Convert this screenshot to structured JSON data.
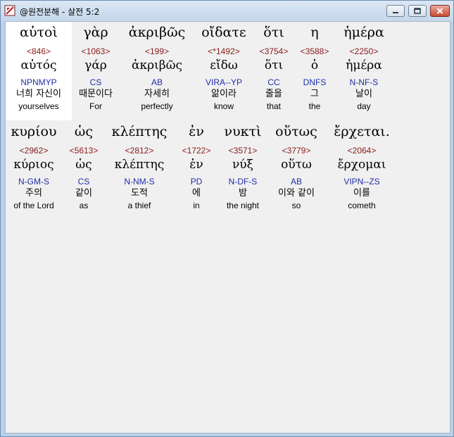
{
  "window": {
    "title": "@원전분해 - 살전 5:2"
  },
  "words": [
    {
      "surface": "αὐτοὶ",
      "strong": "<846>",
      "lemma": "αὐτός",
      "parse": "NPNMYP",
      "korean": "너희 자신이",
      "english": "yourselves"
    },
    {
      "surface": "γὰρ",
      "strong": "<1063>",
      "lemma": "γάρ",
      "parse": "CS",
      "korean": "때문이다",
      "english": "For"
    },
    {
      "surface": "ἀκριβῶς",
      "strong": "<199>",
      "lemma": "ἀκριβῶς",
      "parse": "AB",
      "korean": "자세히",
      "english": "perfectly"
    },
    {
      "surface": "οἴδατε",
      "strong": "<*1492>",
      "lemma": "εἴδω",
      "parse": "VIRA--YP",
      "korean": "앎이라",
      "english": "know"
    },
    {
      "surface": "ὅτι",
      "strong": "<3754>",
      "lemma": "ὅτι",
      "parse": "CC",
      "korean": "줄을",
      "english": "that"
    },
    {
      "surface": "η",
      "strong": "<3588>",
      "lemma": "ὁ",
      "parse": "DNFS",
      "korean": "그",
      "english": "the"
    },
    {
      "surface": "ἡμέρα",
      "strong": "<2250>",
      "lemma": "ἡμέρα",
      "parse": "N-NF-S",
      "korean": "날이",
      "english": "day"
    },
    {
      "surface": "κυρίου",
      "strong": "<2962>",
      "lemma": "κύριος",
      "parse": "N-GM-S",
      "korean": "주의",
      "english": "of the Lord"
    },
    {
      "surface": "ὡς",
      "strong": "<5613>",
      "lemma": "ὡς",
      "parse": "CS",
      "korean": "같이",
      "english": "as"
    },
    {
      "surface": "κλέπτης",
      "strong": "<2812>",
      "lemma": "κλέπτης",
      "parse": "N-NM-S",
      "korean": "도적",
      "english": "a thief"
    },
    {
      "surface": "ἐν",
      "strong": "<1722>",
      "lemma": "ἐν",
      "parse": "PD",
      "korean": "에",
      "english": "in"
    },
    {
      "surface": "νυκτὶ",
      "strong": "<3571>",
      "lemma": "νύξ",
      "parse": "N-DF-S",
      "korean": "밤",
      "english": "the night"
    },
    {
      "surface": "οὕτως",
      "strong": "<3779>",
      "lemma": "οὕτω",
      "parse": "AB",
      "korean": "이와 같이",
      "english": "so"
    },
    {
      "surface": "ἔρχεται.",
      "strong": "<2064>",
      "lemma": "ἔρχομαι",
      "parse": "VIPN--ZS",
      "korean": "이를",
      "english": "cometh"
    }
  ]
}
